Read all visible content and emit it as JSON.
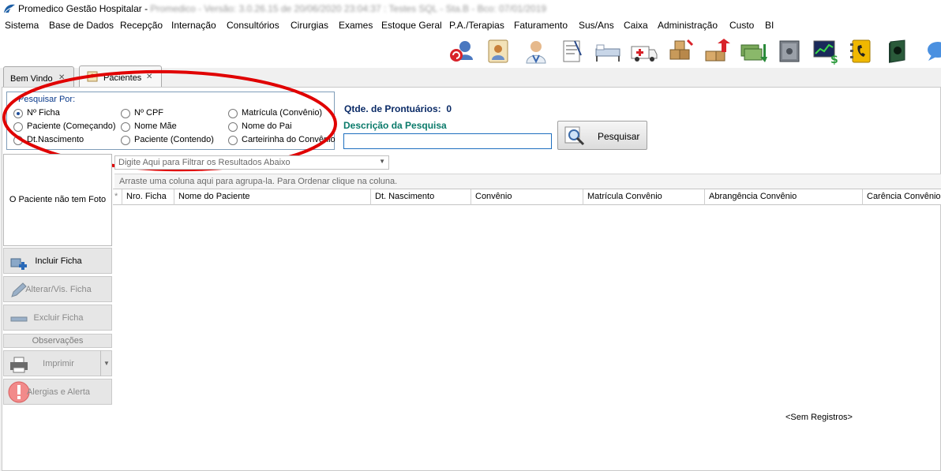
{
  "window": {
    "title": "Promedico Gestão Hospitalar - ",
    "subtitle": "Promedico - Versão: 3.0.26.15 de 20/06/2020 23:04:37 : Testes SQL - Sta.B - Bco: 07/01/2019"
  },
  "menu": {
    "items": [
      "Sistema",
      "Base de Dados",
      "Recepção",
      "Internação",
      "Consultórios",
      "Cirurgias",
      "Exames",
      "Estoque Geral",
      "P.A./Terapias",
      "Faturamento",
      "Sus/Ans",
      "Caixa",
      "Administração",
      "Custo",
      "BI"
    ]
  },
  "tabs": [
    {
      "label": "Bem Vindo"
    },
    {
      "label": "Pacientes"
    }
  ],
  "search": {
    "group_title": "Pesquisar Por:",
    "options": [
      {
        "label": "Nº Ficha",
        "checked": true
      },
      {
        "label": "Paciente (Começando)",
        "checked": false
      },
      {
        "label": "Dt.Nascimento",
        "checked": false
      },
      {
        "label": "Nº CPF",
        "checked": false
      },
      {
        "label": "Nome Mãe",
        "checked": false
      },
      {
        "label": "Paciente (Contendo)",
        "checked": false
      },
      {
        "label": "Matrícula (Convênio)",
        "checked": false
      },
      {
        "label": "Nome do Pai",
        "checked": false
      },
      {
        "label": "Carteirinha do Convênio",
        "checked": false
      }
    ],
    "count_label": "Qtde. de Prontuários:",
    "count_value": "0",
    "description_label": "Descrição da Pesquisa",
    "input_value": "",
    "button_label": "Pesquisar"
  },
  "patient": {
    "no_photo_text": "O Paciente não tem Foto"
  },
  "actions": {
    "include": "Incluir Ficha",
    "edit": "Alterar/Vis. Ficha",
    "delete": "Excluir Ficha",
    "observations": "Observações",
    "print": "Imprimir",
    "allergies": "Alergias e Alerta"
  },
  "grid": {
    "filter_placeholder": "Digite Aqui para Filtrar os Resultados Abaixo",
    "group_hint": "Arraste uma coluna aqui para agrupa-la. Para Ordenar clique na coluna.",
    "indicator": "*",
    "columns": [
      "Nro. Ficha",
      "Nome do Paciente",
      "Dt. Nascimento",
      "Convênio",
      "Matrícula Convênio",
      "Abrangência Convênio",
      "Carência Convênio"
    ],
    "empty_text": "<Sem Registros>"
  },
  "icons": {
    "toolbar": [
      "refresh-users-icon",
      "patient-card-icon",
      "doctor-icon",
      "prescription-icon",
      "bed-icon",
      "ambulance-icon",
      "stock-icon",
      "stock-up-icon",
      "money-icon",
      "safe-icon",
      "stock-chart-icon",
      "phone-book-icon",
      "book-icon",
      "chat-icon"
    ]
  },
  "colors": {
    "annotation": "#e00000",
    "link_blue": "#0a2a66",
    "teal_label": "#0a7a6a"
  }
}
